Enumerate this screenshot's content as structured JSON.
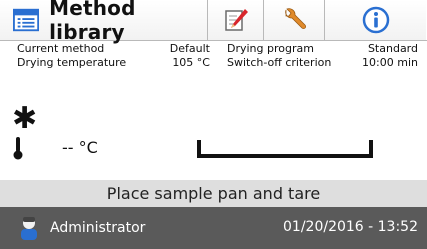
{
  "toolbar": {
    "title": "Method library",
    "icons": {
      "main": "method-library-icon",
      "edit": "pencil-edit-icon",
      "settings": "wrench-icon",
      "info": "info-icon"
    }
  },
  "info": {
    "rows": [
      {
        "left_label": "Current method",
        "left_value": "Default",
        "right_label": "Drying program",
        "right_value": "Standard"
      },
      {
        "left_label": "Drying temperature",
        "left_value": "105 °C",
        "right_label": "Switch-off criterion",
        "right_value": "10:00 min"
      }
    ]
  },
  "display": {
    "asterisk": "✱",
    "temperature": "-- °C"
  },
  "status": {
    "message": "Place sample pan and tare"
  },
  "footer": {
    "user": "Administrator",
    "datetime": "01/20/2016 - 13:52"
  },
  "colors": {
    "footer_bg": "#5a5a5a",
    "status_bg": "#dedede",
    "info_blue": "#2a6fd1",
    "pencil_red": "#d8262c",
    "wrench_orange": "#e08a2b"
  }
}
